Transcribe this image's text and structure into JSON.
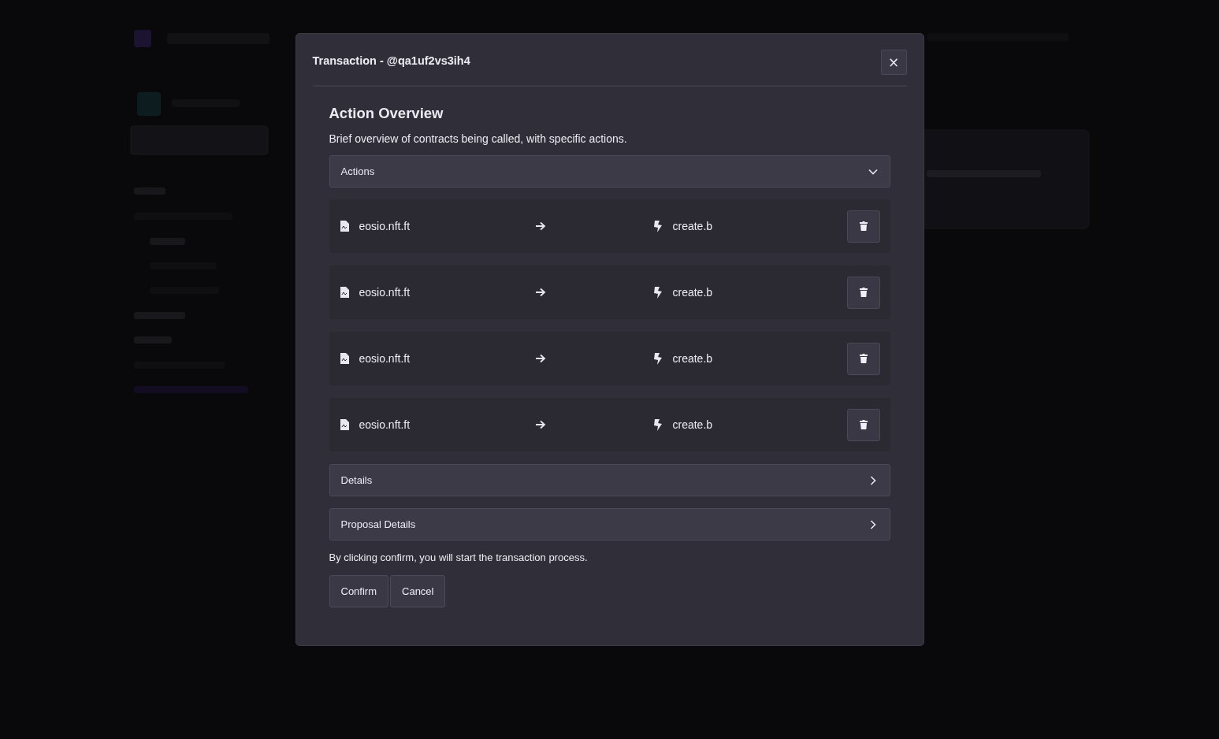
{
  "dialog": {
    "title": "Transaction - @qa1uf2vs3ih4",
    "close_label": "×"
  },
  "overview": {
    "heading": "Action Overview",
    "description": "Brief overview of contracts being called, with specific actions."
  },
  "sections": [
    {
      "label": "Actions",
      "expanded": true,
      "items": [
        {
          "contract": "eosio.nft.ft",
          "action": "create.b"
        },
        {
          "contract": "eosio.nft.ft",
          "action": "create.b"
        },
        {
          "contract": "eosio.nft.ft",
          "action": "create.b"
        },
        {
          "contract": "eosio.nft.ft",
          "action": "create.b"
        }
      ]
    },
    {
      "label": "Details",
      "expanded": false
    },
    {
      "label": "Proposal Details",
      "expanded": false
    }
  ],
  "note": "By clicking confirm, you will start the transaction process.",
  "buttons": [
    "Confirm",
    "Cancel"
  ]
}
